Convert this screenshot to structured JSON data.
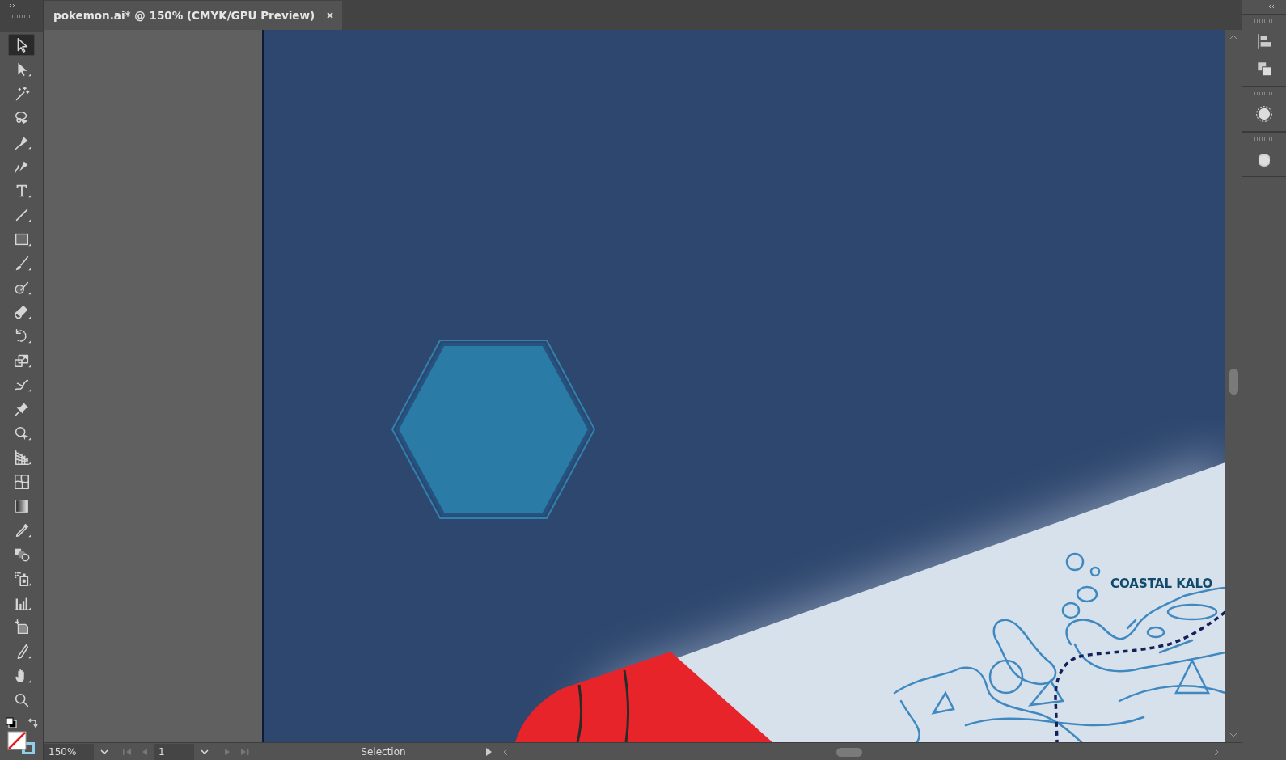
{
  "document_tab": {
    "title": "pokemon.ai* @ 150% (CMYK/GPU Preview)",
    "selected": true
  },
  "tools": [
    {
      "selected": true
    },
    {
      "selected": false
    },
    {
      "selected": false
    },
    {
      "selected": false
    },
    {
      "selected": false
    },
    {
      "selected": false
    },
    {
      "selected": false
    },
    {
      "selected": false
    },
    {
      "selected": false
    },
    {
      "selected": false
    },
    {
      "selected": false
    },
    {
      "selected": false
    },
    {
      "selected": false
    },
    {
      "selected": false
    },
    {
      "selected": false
    },
    {
      "selected": false
    },
    {
      "selected": false
    },
    {
      "selected": false
    },
    {
      "selected": false
    },
    {
      "selected": false
    },
    {
      "selected": false
    },
    {
      "selected": false
    },
    {
      "selected": false
    },
    {
      "selected": false
    },
    {
      "selected": false
    },
    {
      "selected": false
    },
    {
      "selected": false
    },
    {
      "selected": false
    }
  ],
  "artboard": {
    "map_label": "COASTAL KALO"
  },
  "status_bar": {
    "zoom": "150%",
    "artboard_number": "1",
    "info": "Selection"
  }
}
